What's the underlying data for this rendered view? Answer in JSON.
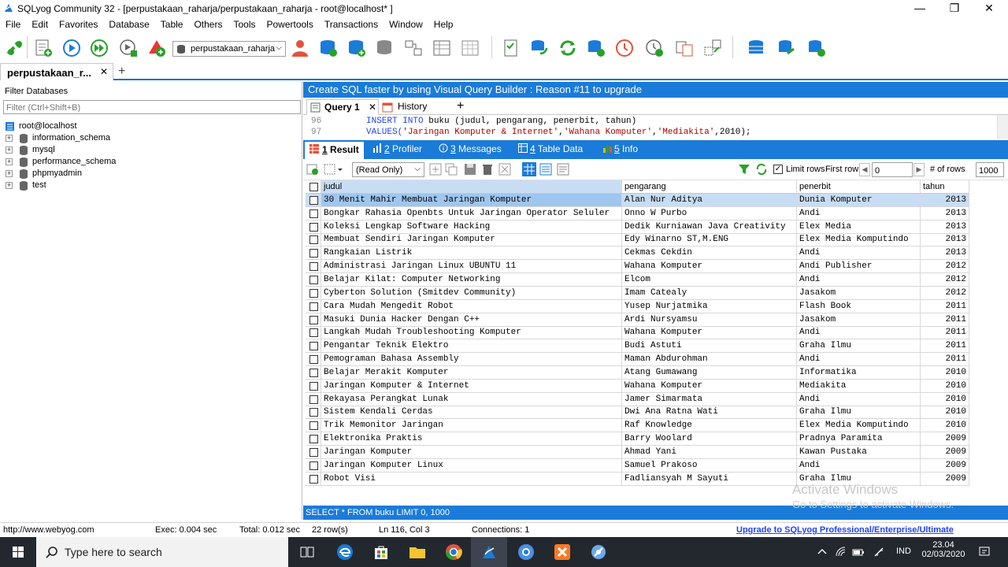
{
  "window": {
    "title": "SQLyog Community 32 - [perpustakaan_raharja/perpustakaan_raharja - root@localhost* ]",
    "minimize": "—",
    "restore": "❐",
    "close": "✕"
  },
  "menu": [
    "File",
    "Edit",
    "Favorites",
    "Database",
    "Table",
    "Others",
    "Tools",
    "Powertools",
    "Transactions",
    "Window",
    "Help"
  ],
  "toolbar": {
    "database_select": "perpustakaan_raharja",
    "icons": [
      "new-connection-icon",
      "new-query-icon",
      "execute-query-icon",
      "execute-all-icon",
      "execute-edit-icon",
      "refresh-object-browser-icon",
      "user-manager-icon",
      "backup-icon",
      "restore-icon",
      "data-sync-icon",
      "schema-designer-icon",
      "query-builder-icon",
      "table-diff-icon",
      "import-icon",
      "export-icon",
      "copy-db-icon",
      "sync-icon",
      "export-excel-icon",
      "scheduled-icon",
      "job-agent-icon",
      "history-icon",
      "compare-icon",
      "database-icon",
      "database-add-icon",
      "database-refresh-icon"
    ]
  },
  "connection_tab": {
    "label": "perpustakaan_r...",
    "close": "✕",
    "add": "+"
  },
  "left_panel": {
    "filter_label": "Filter Databases",
    "filter_placeholder": "Filter (Ctrl+Shift+B)",
    "root": "root@localhost",
    "databases": [
      "information_schema",
      "mysql",
      "performance_schema",
      "phpmyadmin",
      "test"
    ]
  },
  "promo": "Create SQL faster by using Visual Query Builder : Reason #11 to upgrade",
  "query_tabs": {
    "query": "Query 1",
    "history": "History",
    "add": "+"
  },
  "editor": {
    "lines": [
      {
        "num": "96",
        "parts": [
          {
            "t": "INSERT INTO ",
            "c": "kw"
          },
          {
            "t": "buku (judul, pengarang, penerbit, tahun)",
            "c": ""
          }
        ]
      },
      {
        "num": "97",
        "parts": [
          {
            "t": "VALUES(",
            "c": "kw"
          },
          {
            "t": "'Jaringan Komputer & Internet'",
            "c": "str"
          },
          {
            "t": ",",
            "c": ""
          },
          {
            "t": "'Wahana Komputer'",
            "c": "str"
          },
          {
            "t": ",",
            "c": ""
          },
          {
            "t": "'Mediakita'",
            "c": "str"
          },
          {
            "t": ",2010);",
            "c": ""
          }
        ]
      }
    ]
  },
  "result_tabs": [
    {
      "num": "1",
      "label": " Result"
    },
    {
      "num": "2",
      "label": " Profiler"
    },
    {
      "num": "3",
      "label": " Messages"
    },
    {
      "num": "4",
      "label": " Table Data"
    },
    {
      "num": "5",
      "label": " Info"
    }
  ],
  "result_toolbar": {
    "readonly": "(Read Only)",
    "limit_rows": "Limit rows",
    "first_row_label": "First row",
    "first_row_value": "0",
    "num_rows_label": "# of rows",
    "num_rows_value": "1000"
  },
  "grid": {
    "columns": [
      "judul",
      "pengarang",
      "penerbit",
      "tahun"
    ],
    "rows": [
      [
        "30 Menit Mahir Membuat Jaringan Komputer",
        "Alan Nur Aditya",
        "Dunia Komputer",
        "2013"
      ],
      [
        "Bongkar Rahasia Openbts Untuk Jaringan Operator Seluler",
        "Onno W Purbo",
        "Andi",
        "2013"
      ],
      [
        "Koleksi Lengkap Software Hacking",
        "Dedik Kurniawan Java Creativity",
        "Elex Media",
        "2013"
      ],
      [
        "Membuat Sendiri Jaringan Komputer",
        "Edy Winarno ST,M.ENG",
        "Elex Media Komputindo",
        "2013"
      ],
      [
        "Rangkaian Listrik",
        "Cekmas Cekdin",
        "Andi",
        "2013"
      ],
      [
        "Administrasi Jaringan Linux UBUNTU 11",
        "Wahana Komputer",
        "Andi Publisher",
        "2012"
      ],
      [
        "Belajar Kilat: Computer Networking",
        "Elcom",
        "Andi",
        "2012"
      ],
      [
        "Cyberton Solution (Smitdev Community)",
        "Imam Catealy",
        "Jasakom",
        "2012"
      ],
      [
        "Cara Mudah Mengedit Robot",
        "Yusep Nurjatmika",
        "Flash Book",
        "2011"
      ],
      [
        "Masuki Dunia Hacker Dengan C++",
        "Ardi Nursyamsu",
        "Jasakom",
        "2011"
      ],
      [
        "Langkah Mudah Troubleshooting Komputer",
        "Wahana Komputer",
        "Andi",
        "2011"
      ],
      [
        "Pengantar Teknik Elektro",
        "Budi Astuti",
        "Graha Ilmu",
        "2011"
      ],
      [
        "Pemograman Bahasa Assembly",
        "Maman Abdurohman",
        "Andi",
        "2011"
      ],
      [
        "Belajar Merakit Komputer",
        "Atang Gumawang",
        "Informatika",
        "2010"
      ],
      [
        "Jaringan Komputer & Internet",
        "Wahana Komputer",
        "Mediakita",
        "2010"
      ],
      [
        "Rekayasa Perangkat Lunak",
        "Jamer Simarmata",
        "Andi",
        "2010"
      ],
      [
        "Sistem Kendali Cerdas",
        "Dwi Ana Ratna Wati",
        "Graha Ilmu",
        "2010"
      ],
      [
        "Trik Memonitor Jaringan",
        "Raf Knowledge",
        "Elex Media Komputindo",
        "2010"
      ],
      [
        "Elektronika Praktis",
        "Barry Woolard",
        "Pradnya Paramita",
        "2009"
      ],
      [
        "Jaringan Komputer",
        "Ahmad Yani",
        "Kawan Pustaka",
        "2009"
      ],
      [
        "Jaringan Komputer Linux",
        "Samuel Prakoso",
        "Andi",
        "2009"
      ],
      [
        "Robot Visi",
        "Fadliansyah M Sayuti",
        "Graha Ilmu",
        "2009"
      ]
    ]
  },
  "sql_status": "SELECT * FROM buku LIMIT 0, 1000",
  "watermark": {
    "line1": "Activate Windows",
    "line2": "Go to Settings to activate Windows."
  },
  "statusbar": {
    "url": "http://www.webyog.com",
    "exec": "Exec: 0.004 sec",
    "total": "Total: 0.012 sec",
    "rows": "22 row(s)",
    "position": "Ln 116, Col 3",
    "connections": "Connections: 1",
    "upgrade": "Upgrade to SQLyog Professional/Enterprise/Ultimate"
  },
  "taskbar": {
    "search_placeholder": "Type here to search",
    "language": "IND",
    "time": "23.04",
    "date": "02/03/2020"
  },
  "colors": {
    "accent": "#1b7bd8",
    "selection": "#c8ddf4",
    "taskbar": "#23282f"
  }
}
